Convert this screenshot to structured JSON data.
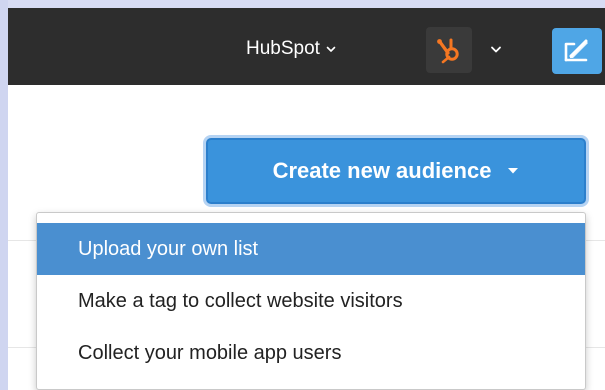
{
  "topbar": {
    "account_name": "HubSpot",
    "account_chevron_icon": "chevron-down-icon",
    "product_logo_icon": "hubspot-sprocket-icon",
    "product_chevron_icon": "chevron-down-icon",
    "compose_icon": "compose-icon"
  },
  "toolbar": {
    "create_label": "Create new audience",
    "create_caret_icon": "caret-down-icon"
  },
  "menu": {
    "items": [
      {
        "label": "Upload your own list",
        "active": true
      },
      {
        "label": "Make a tag to collect website visitors",
        "active": false
      },
      {
        "label": "Collect your mobile app users",
        "active": false
      }
    ]
  },
  "colors": {
    "topbar_bg": "#2d2d2d",
    "accent_blue": "#3a93dc",
    "menu_highlight": "#4a8fd0",
    "hubspot_orange": "#f57722",
    "frame": "#d7dcf3"
  }
}
